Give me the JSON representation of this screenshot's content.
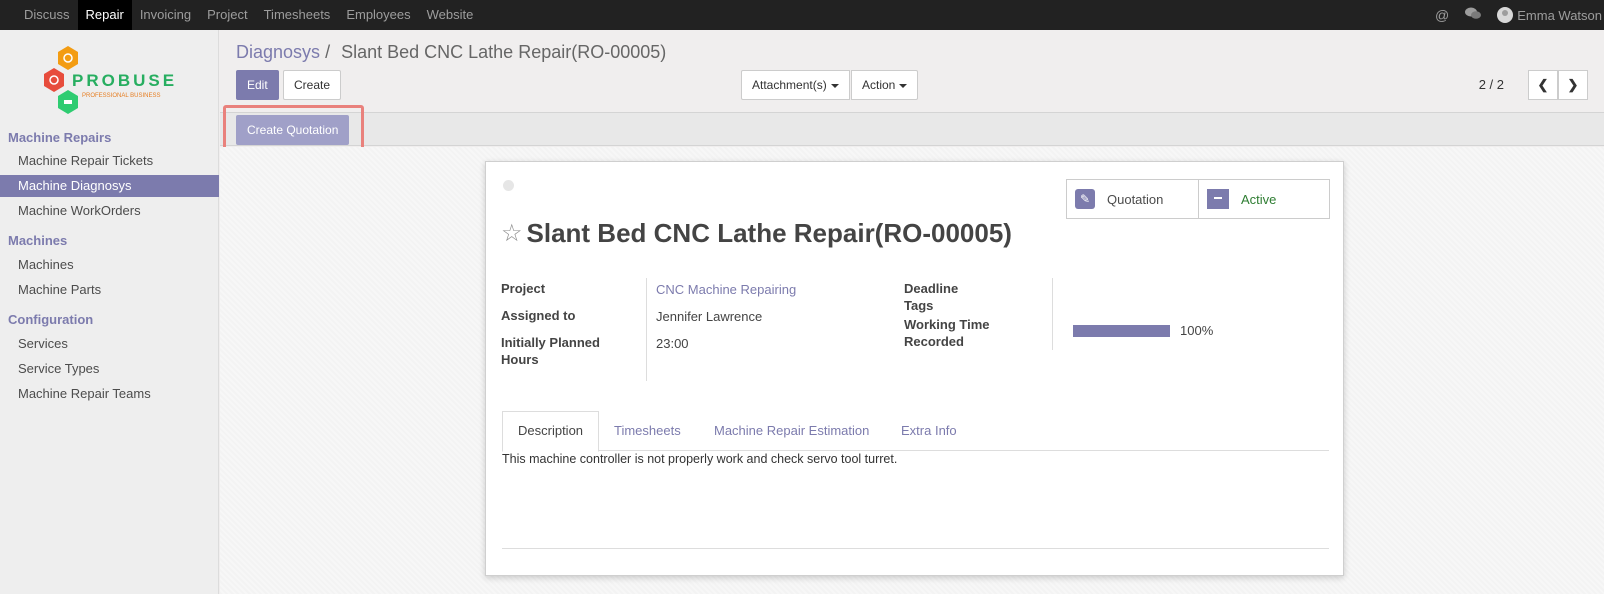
{
  "topnav": {
    "items": [
      {
        "label": "Discuss",
        "active": false
      },
      {
        "label": "Repair",
        "active": true
      },
      {
        "label": "Invoicing",
        "active": false
      },
      {
        "label": "Project",
        "active": false
      },
      {
        "label": "Timesheets",
        "active": false
      },
      {
        "label": "Employees",
        "active": false
      },
      {
        "label": "Website",
        "active": false
      }
    ],
    "user_name": "Emma Watson",
    "icons": [
      "at-icon",
      "chat-icon"
    ]
  },
  "logo": {
    "text": "PROBUSE",
    "tagline": "PROFESSIONAL BUSINESS"
  },
  "sidebar": {
    "section_repairs": "Machine Repairs",
    "section_machines": "Machines",
    "section_config": "Configuration",
    "items": [
      {
        "label": "Machine Repair Tickets"
      },
      {
        "label": "Machine Diagnosys"
      },
      {
        "label": "Machine WorkOrders"
      },
      {
        "label": "Machines"
      },
      {
        "label": "Machine Parts"
      },
      {
        "label": "Services"
      },
      {
        "label": "Service Types"
      },
      {
        "label": "Machine Repair Teams"
      }
    ],
    "active_item": "Machine Diagnosys"
  },
  "breadcrumb": {
    "parent": "Diagnosys",
    "separator": "/",
    "current": "Slant Bed CNC Lathe Repair(RO-00005)"
  },
  "toolbar": {
    "edit": "Edit",
    "create": "Create",
    "attachments": "Attachment(s)",
    "action": "Action",
    "pager": "2 / 2"
  },
  "statusbar": {
    "create_quotation": "Create Quotation"
  },
  "record": {
    "title": "Slant Bed CNC Lathe Repair(RO-00005)",
    "smart_buttons": {
      "quotation": "Quotation",
      "active": "Active"
    },
    "labels": {
      "project": "Project",
      "assigned_to": "Assigned to",
      "planned_hours": "Initially Planned Hours",
      "deadline": "Deadline",
      "tags": "Tags",
      "working_time": "Working Time Recorded"
    },
    "values": {
      "project": "CNC Machine Repairing",
      "assigned_to": "Jennifer Lawrence",
      "planned_hours": "23:00",
      "working_time_percent": 100,
      "working_time_text": "100%"
    },
    "tabs": [
      {
        "label": "Description",
        "active": true
      },
      {
        "label": "Timesheets",
        "active": false
      },
      {
        "label": "Machine Repair Estimation",
        "active": false
      },
      {
        "label": "Extra Info",
        "active": false
      }
    ],
    "description": "This machine controller is not properly work and check servo tool turret."
  },
  "colors": {
    "accent": "#7c7bad",
    "active_status": "#2e7d32",
    "highlight": "#e9817c",
    "topbar": "#222222"
  }
}
